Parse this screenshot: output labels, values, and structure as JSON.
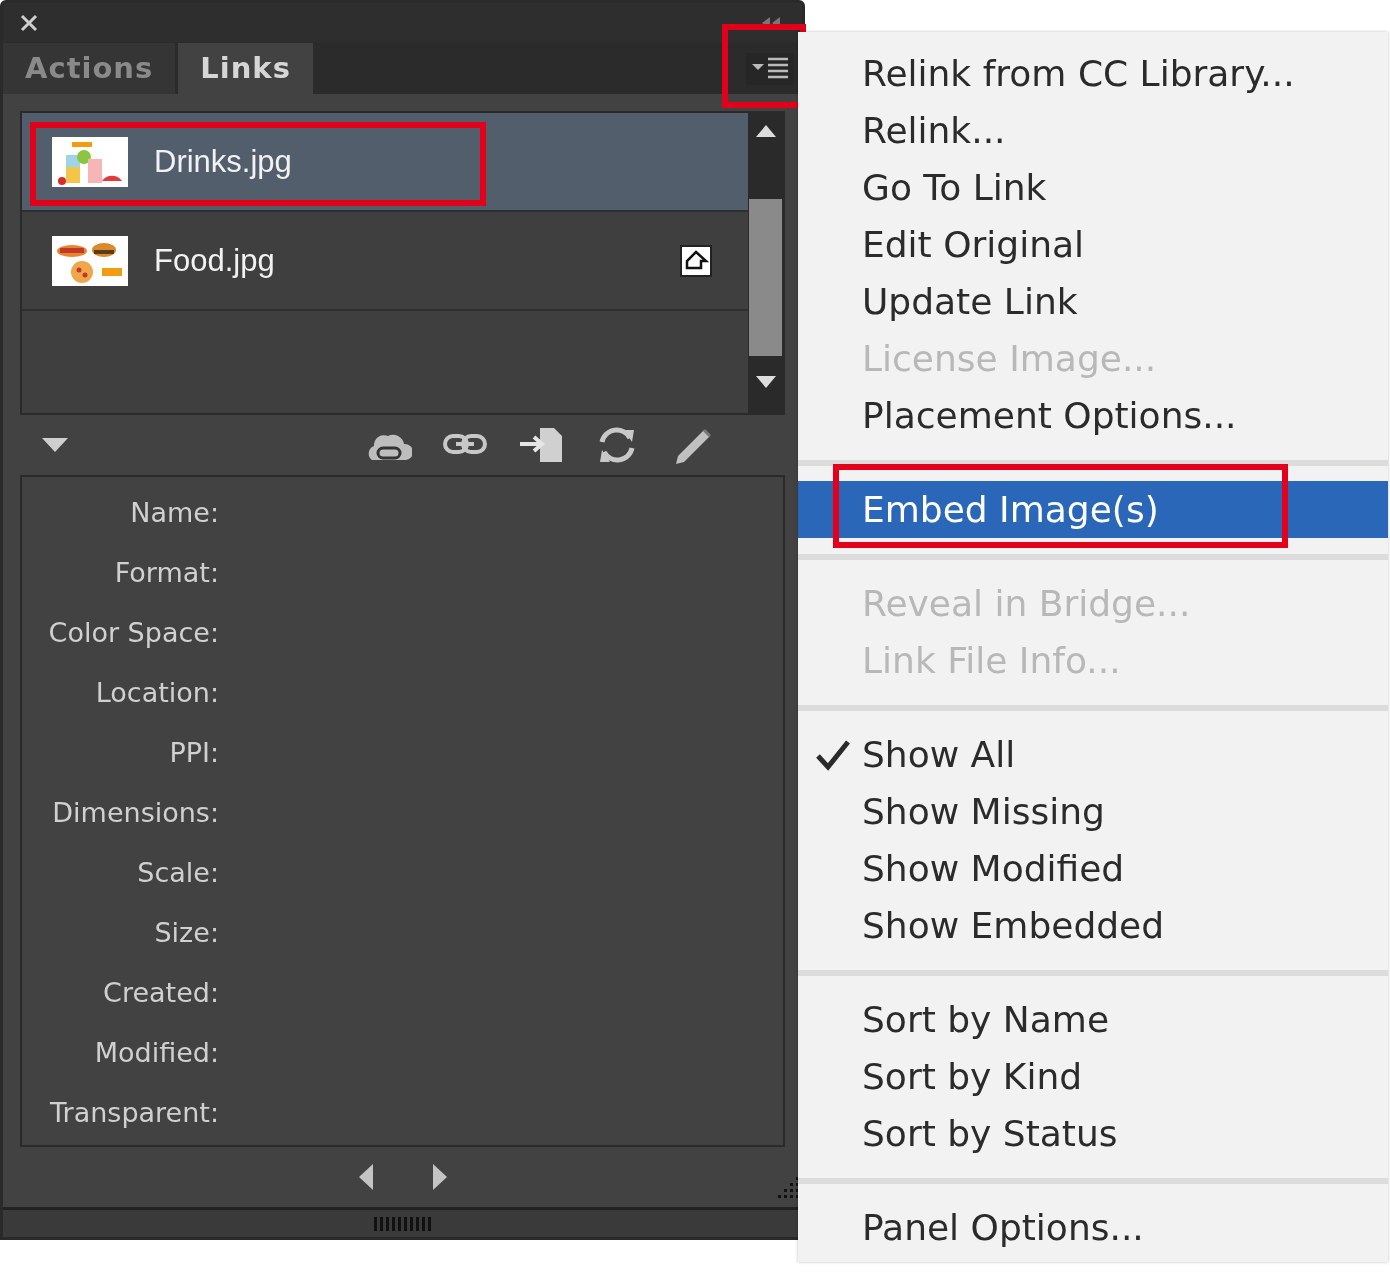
{
  "panel": {
    "tabs": [
      {
        "label": "Actions",
        "selected": false
      },
      {
        "label": "Links",
        "selected": true
      }
    ],
    "menu_button": {
      "annotated": true
    },
    "links": [
      {
        "name": "Drinks.jpg",
        "selected": true,
        "annotated": true,
        "embedded": false
      },
      {
        "name": "Food.jpg",
        "selected": false,
        "annotated": false,
        "embedded": true
      }
    ],
    "info_labels": [
      "Name:",
      "Format:",
      "Color Space:",
      "Location:",
      "PPI:",
      "Dimensions:",
      "Scale:",
      "Size:",
      "Created:",
      "Modified:",
      "Transparent:"
    ]
  },
  "menu": {
    "items": [
      {
        "kind": "item",
        "label": "Relink from CC Library...",
        "disabled": false,
        "checked": false,
        "selected": false,
        "annotated": false
      },
      {
        "kind": "item",
        "label": "Relink...",
        "disabled": false,
        "checked": false,
        "selected": false,
        "annotated": false
      },
      {
        "kind": "item",
        "label": "Go To Link",
        "disabled": false,
        "checked": false,
        "selected": false,
        "annotated": false
      },
      {
        "kind": "item",
        "label": "Edit Original",
        "disabled": false,
        "checked": false,
        "selected": false,
        "annotated": false
      },
      {
        "kind": "item",
        "label": "Update Link",
        "disabled": false,
        "checked": false,
        "selected": false,
        "annotated": false
      },
      {
        "kind": "item",
        "label": "License Image...",
        "disabled": true,
        "checked": false,
        "selected": false,
        "annotated": false
      },
      {
        "kind": "item",
        "label": "Placement Options...",
        "disabled": false,
        "checked": false,
        "selected": false,
        "annotated": false
      },
      {
        "kind": "separator"
      },
      {
        "kind": "item",
        "label": "Embed Image(s)",
        "disabled": false,
        "checked": false,
        "selected": true,
        "annotated": true
      },
      {
        "kind": "separator"
      },
      {
        "kind": "item",
        "label": "Reveal in Bridge...",
        "disabled": true,
        "checked": false,
        "selected": false,
        "annotated": false
      },
      {
        "kind": "item",
        "label": "Link File Info...",
        "disabled": true,
        "checked": false,
        "selected": false,
        "annotated": false
      },
      {
        "kind": "separator"
      },
      {
        "kind": "item",
        "label": "Show All",
        "disabled": false,
        "checked": true,
        "selected": false,
        "annotated": false
      },
      {
        "kind": "item",
        "label": "Show Missing",
        "disabled": false,
        "checked": false,
        "selected": false,
        "annotated": false
      },
      {
        "kind": "item",
        "label": "Show Modified",
        "disabled": false,
        "checked": false,
        "selected": false,
        "annotated": false
      },
      {
        "kind": "item",
        "label": "Show Embedded",
        "disabled": false,
        "checked": false,
        "selected": false,
        "annotated": false
      },
      {
        "kind": "separator"
      },
      {
        "kind": "item",
        "label": "Sort by Name",
        "disabled": false,
        "checked": false,
        "selected": false,
        "annotated": false
      },
      {
        "kind": "item",
        "label": "Sort by Kind",
        "disabled": false,
        "checked": false,
        "selected": false,
        "annotated": false
      },
      {
        "kind": "item",
        "label": "Sort by Status",
        "disabled": false,
        "checked": false,
        "selected": false,
        "annotated": false
      },
      {
        "kind": "separator"
      },
      {
        "kind": "item",
        "label": "Panel Options...",
        "disabled": false,
        "checked": false,
        "selected": false,
        "annotated": false
      }
    ]
  }
}
